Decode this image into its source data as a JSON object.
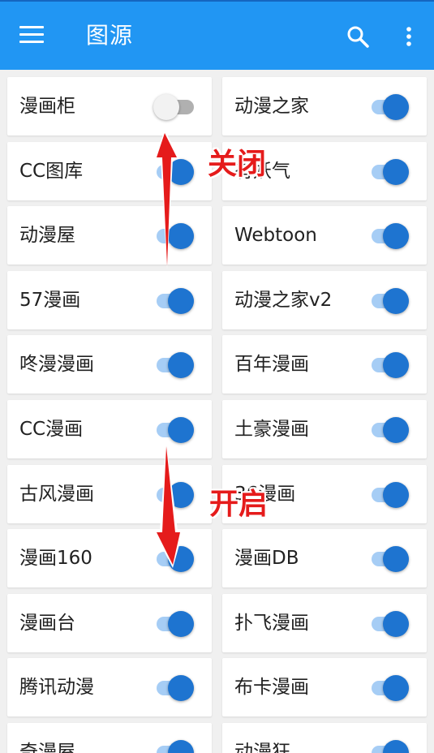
{
  "appbar": {
    "title": "图源",
    "menu_icon": "menu-icon",
    "search_icon": "search-icon",
    "more_icon": "more-vert-icon"
  },
  "colors": {
    "appbar": "#2196f3",
    "toggle_on_thumb": "#1e74d0",
    "toggle_on_track": "#a6cdf5",
    "toggle_off_thumb": "#f2f2f2",
    "toggle_off_track": "#b0b0b0",
    "annotation": "#e51b1b"
  },
  "sources": [
    {
      "name": "漫画柜",
      "enabled": false
    },
    {
      "name": "动漫之家",
      "enabled": true
    },
    {
      "name": "CC图库",
      "enabled": true
    },
    {
      "name": "有妖气",
      "enabled": true
    },
    {
      "name": "动漫屋",
      "enabled": true
    },
    {
      "name": "Webtoon",
      "enabled": true
    },
    {
      "name": "57漫画",
      "enabled": true
    },
    {
      "name": "动漫之家v2",
      "enabled": true
    },
    {
      "name": "咚漫漫画",
      "enabled": true
    },
    {
      "name": "百年漫画",
      "enabled": true
    },
    {
      "name": "CC漫画",
      "enabled": true
    },
    {
      "name": "土豪漫画",
      "enabled": true
    },
    {
      "name": "古风漫画",
      "enabled": true
    },
    {
      "name": "36漫画",
      "enabled": true
    },
    {
      "name": "漫画160",
      "enabled": true
    },
    {
      "name": "漫画DB",
      "enabled": true
    },
    {
      "name": "漫画台",
      "enabled": true
    },
    {
      "name": "扑飞漫画",
      "enabled": true
    },
    {
      "name": "腾讯动漫",
      "enabled": true
    },
    {
      "name": "布卡漫画",
      "enabled": true
    },
    {
      "name": "奇漫屋",
      "enabled": true
    },
    {
      "name": "动漫狂",
      "enabled": true
    }
  ],
  "annotations": {
    "off_label": "关闭",
    "on_label": "开启"
  }
}
